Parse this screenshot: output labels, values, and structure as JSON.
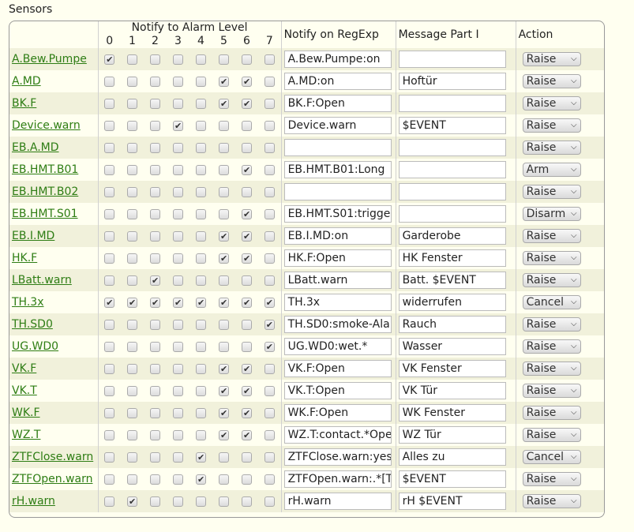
{
  "section_title": "Sensors",
  "header": {
    "group_label": "Notify to Alarm Level",
    "levels": [
      "0",
      "1",
      "2",
      "3",
      "4",
      "5",
      "6",
      "7"
    ],
    "regexp_label": "Notify on RegExp",
    "message_label": "Message Part I",
    "action_label": "Action"
  },
  "rows": [
    {
      "name": "A.Bew.Pumpe",
      "levels": [
        1,
        0,
        0,
        0,
        0,
        0,
        0,
        0
      ],
      "regexp": "A.Bew.Pumpe:on",
      "message": "",
      "action": "Raise"
    },
    {
      "name": "A.MD",
      "levels": [
        0,
        0,
        0,
        0,
        0,
        1,
        1,
        0
      ],
      "regexp": "A.MD:on",
      "message": "Hoftür",
      "action": "Raise"
    },
    {
      "name": "BK.F",
      "levels": [
        0,
        0,
        0,
        0,
        0,
        1,
        1,
        0
      ],
      "regexp": "BK.F:Open",
      "message": "",
      "action": "Raise"
    },
    {
      "name": "Device.warn",
      "levels": [
        0,
        0,
        0,
        1,
        0,
        0,
        0,
        0
      ],
      "regexp": "Device.warn",
      "message": "$EVENT",
      "action": "Raise"
    },
    {
      "name": "EB.A.MD",
      "levels": [
        0,
        0,
        0,
        0,
        0,
        0,
        0,
        0
      ],
      "regexp": "",
      "message": "",
      "action": "Raise"
    },
    {
      "name": "EB.HMT.B01",
      "levels": [
        0,
        0,
        0,
        0,
        0,
        0,
        1,
        0
      ],
      "regexp": "EB.HMT.B01:Long",
      "message": "",
      "action": "Arm"
    },
    {
      "name": "EB.HMT.B02",
      "levels": [
        0,
        0,
        0,
        0,
        0,
        0,
        0,
        0
      ],
      "regexp": "",
      "message": "",
      "action": "Raise"
    },
    {
      "name": "EB.HMT.S01",
      "levels": [
        0,
        0,
        0,
        0,
        0,
        0,
        1,
        0
      ],
      "regexp": "EB.HMT.S01:trigge",
      "message": "",
      "action": "Disarm"
    },
    {
      "name": "EB.I.MD",
      "levels": [
        0,
        0,
        0,
        0,
        0,
        1,
        1,
        0
      ],
      "regexp": "EB.I.MD:on",
      "message": "Garderobe",
      "action": "Raise"
    },
    {
      "name": "HK.F",
      "levels": [
        0,
        0,
        0,
        0,
        0,
        1,
        1,
        0
      ],
      "regexp": "HK.F:Open",
      "message": "HK Fenster",
      "action": "Raise"
    },
    {
      "name": "LBatt.warn",
      "levels": [
        0,
        0,
        1,
        0,
        0,
        0,
        0,
        0
      ],
      "regexp": "LBatt.warn",
      "message": "Batt. $EVENT",
      "action": "Raise"
    },
    {
      "name": "TH.3x",
      "levels": [
        1,
        1,
        1,
        1,
        1,
        1,
        1,
        1
      ],
      "regexp": "TH.3x",
      "message": "widerrufen",
      "action": "Cancel"
    },
    {
      "name": "TH.SD0",
      "levels": [
        0,
        0,
        0,
        0,
        0,
        0,
        0,
        1
      ],
      "regexp": "TH.SD0:smoke-Ala",
      "message": "Rauch",
      "action": "Raise"
    },
    {
      "name": "UG.WD0",
      "levels": [
        0,
        0,
        0,
        0,
        0,
        0,
        0,
        1
      ],
      "regexp": "UG.WD0:wet.*",
      "message": "Wasser",
      "action": "Raise"
    },
    {
      "name": "VK.F",
      "levels": [
        0,
        0,
        0,
        0,
        0,
        1,
        1,
        0
      ],
      "regexp": "VK.F:Open",
      "message": "VK Fenster",
      "action": "Raise"
    },
    {
      "name": "VK.T",
      "levels": [
        0,
        0,
        0,
        0,
        0,
        1,
        1,
        0
      ],
      "regexp": "VK.T:Open",
      "message": "VK Tür",
      "action": "Raise"
    },
    {
      "name": "WK.F",
      "levels": [
        0,
        0,
        0,
        0,
        0,
        1,
        1,
        0
      ],
      "regexp": "WK.F:Open",
      "message": "WK Fenster",
      "action": "Raise"
    },
    {
      "name": "WZ.T",
      "levels": [
        0,
        0,
        0,
        0,
        0,
        1,
        1,
        0
      ],
      "regexp": "WZ.T:contact.*Oper",
      "message": "WZ Tür",
      "action": "Raise"
    },
    {
      "name": "ZTFClose.warn",
      "levels": [
        0,
        0,
        0,
        0,
        1,
        0,
        0,
        0
      ],
      "regexp": "ZTFClose.warn:yes",
      "message": "Alles zu",
      "action": "Cancel"
    },
    {
      "name": "ZTFOpen.warn",
      "levels": [
        0,
        0,
        0,
        0,
        1,
        0,
        0,
        0
      ],
      "regexp": "ZTFOpen.warn:.*[T",
      "message": "$EVENT",
      "action": "Raise"
    },
    {
      "name": "rH.warn",
      "levels": [
        0,
        1,
        0,
        0,
        0,
        0,
        0,
        0
      ],
      "regexp": "rH.warn",
      "message": "rH $EVENT",
      "action": "Raise"
    }
  ]
}
